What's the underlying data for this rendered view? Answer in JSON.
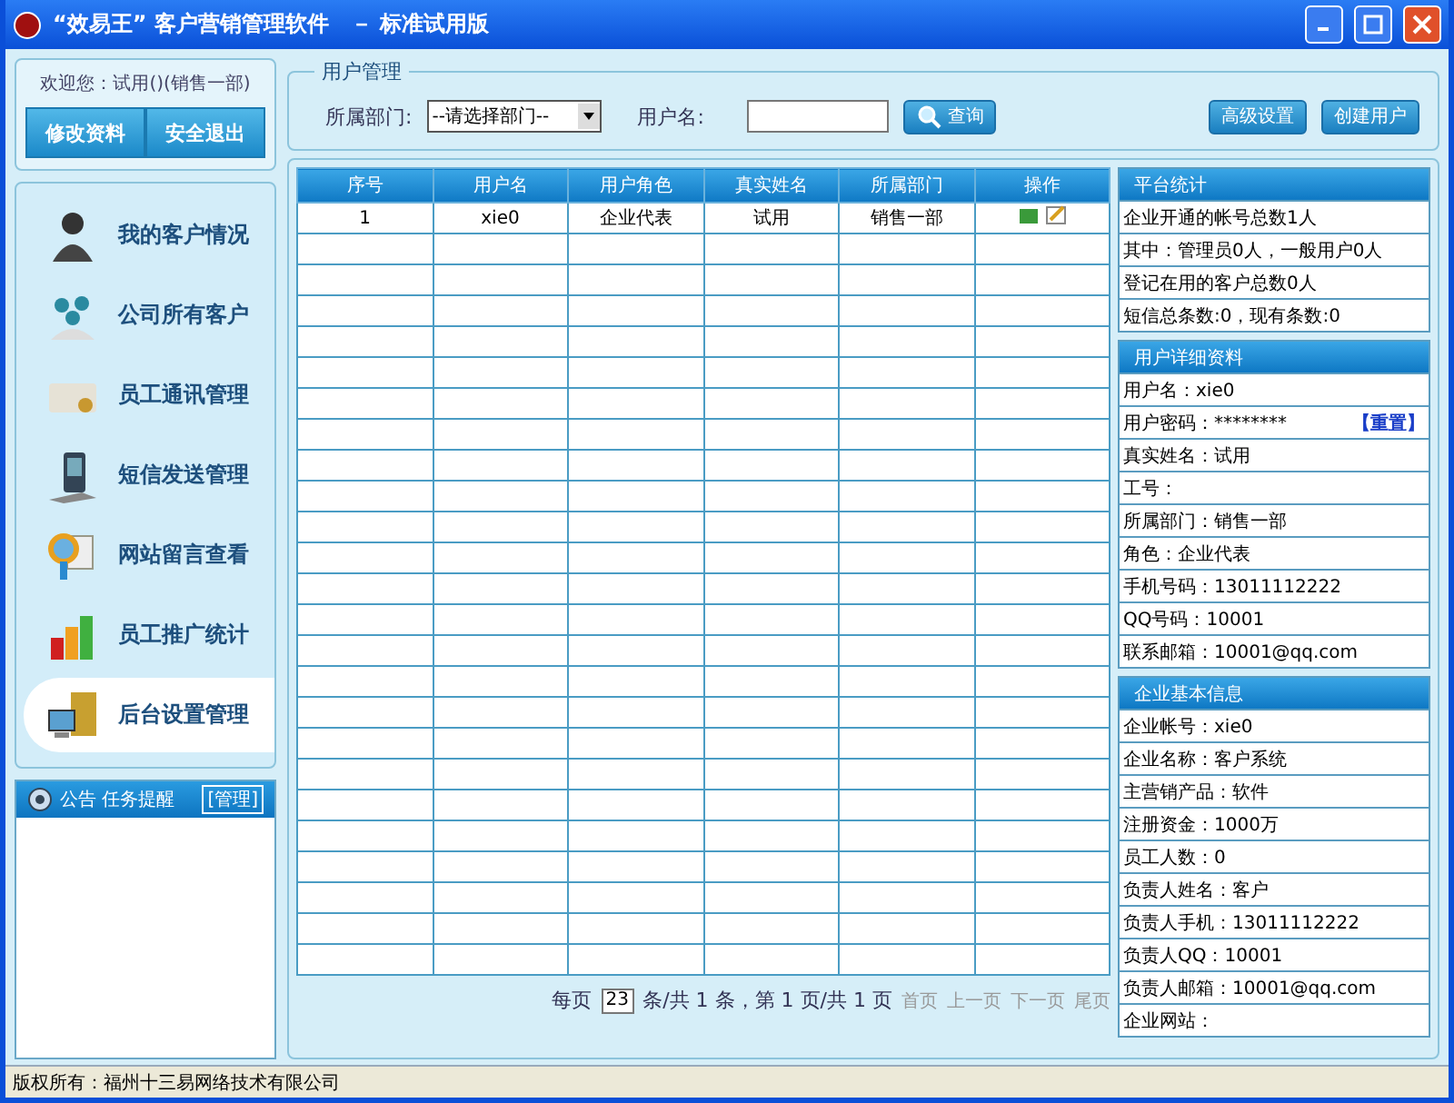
{
  "window": {
    "title": "“效易王” 客户营销管理软件　－ 标准试用版"
  },
  "user_box": {
    "welcome": "欢迎您：试用()(销售一部)",
    "buttons": [
      "修改资料",
      "安全退出"
    ]
  },
  "nav": [
    {
      "label": "我的客户情况",
      "kind": "person",
      "selected": false
    },
    {
      "label": "公司所有客户",
      "kind": "group",
      "selected": false
    },
    {
      "label": "员工通讯管理",
      "kind": "card",
      "selected": false
    },
    {
      "label": "短信发送管理",
      "kind": "phone",
      "selected": false
    },
    {
      "label": "网站留言查看",
      "kind": "magnifier",
      "selected": false
    },
    {
      "label": "员工推广统计",
      "kind": "chart",
      "selected": false
    },
    {
      "label": "后台设置管理",
      "kind": "settings",
      "selected": true
    }
  ],
  "notice": {
    "title": "公告 任务提醒",
    "manage": "[管理]"
  },
  "filter": {
    "legend": "用户管理",
    "dept_label": "所属部门:",
    "dept_value": "--请选择部门--",
    "name_label": "用户名:",
    "search": "查询",
    "buttons": [
      "高级设置",
      "创建用户"
    ]
  },
  "table": {
    "columns": [
      "序号",
      "用户名",
      "用户角色",
      "真实姓名",
      "所属部门",
      "操作"
    ],
    "rows": [
      [
        "1",
        "xie0",
        "企业代表",
        "试用",
        "销售一部"
      ]
    ]
  },
  "pager": {
    "per_page_label": "每页",
    "per_page": "23",
    "summary": "条/共 1 条，第 1 页/共 1 页",
    "links": [
      "首页",
      "上一页",
      "下一页",
      "尾页"
    ]
  },
  "panels": [
    {
      "title": "平台统计",
      "lines": [
        {
          "text": "企业开通的帐号总数1人"
        },
        {
          "text": "其中：管理员0人，一般用户0人"
        },
        {
          "text": "登记在用的客户总数0人"
        },
        {
          "text": "短信总条数:0，现有条数:0"
        }
      ]
    },
    {
      "title": "用户详细资料",
      "lines": [
        {
          "text": "用户名：xie0"
        },
        {
          "text": "用户密码：********",
          "link": "【重置】"
        },
        {
          "text": "真实姓名：试用"
        },
        {
          "text": "工号："
        },
        {
          "text": "所属部门：销售一部"
        },
        {
          "text": "角色：企业代表"
        },
        {
          "text": "手机号码：13011112222"
        },
        {
          "text": "QQ号码：10001"
        },
        {
          "text": "联系邮箱：10001@qq.com"
        }
      ]
    },
    {
      "title": "企业基本信息",
      "lines": [
        {
          "text": "企业帐号：xie0"
        },
        {
          "text": "企业名称：客户系统"
        },
        {
          "text": "主营销产品：软件"
        },
        {
          "text": "注册资金：1000万"
        },
        {
          "text": "员工人数：0"
        },
        {
          "text": "负责人姓名：客户"
        },
        {
          "text": "负责人手机：13011112222"
        },
        {
          "text": "负责人QQ：10001"
        },
        {
          "text": "负责人邮箱：10001@qq.com"
        },
        {
          "text": "企业网站："
        }
      ]
    }
  ],
  "status_bar": "版权所有：福州十三易网络技术有限公司"
}
